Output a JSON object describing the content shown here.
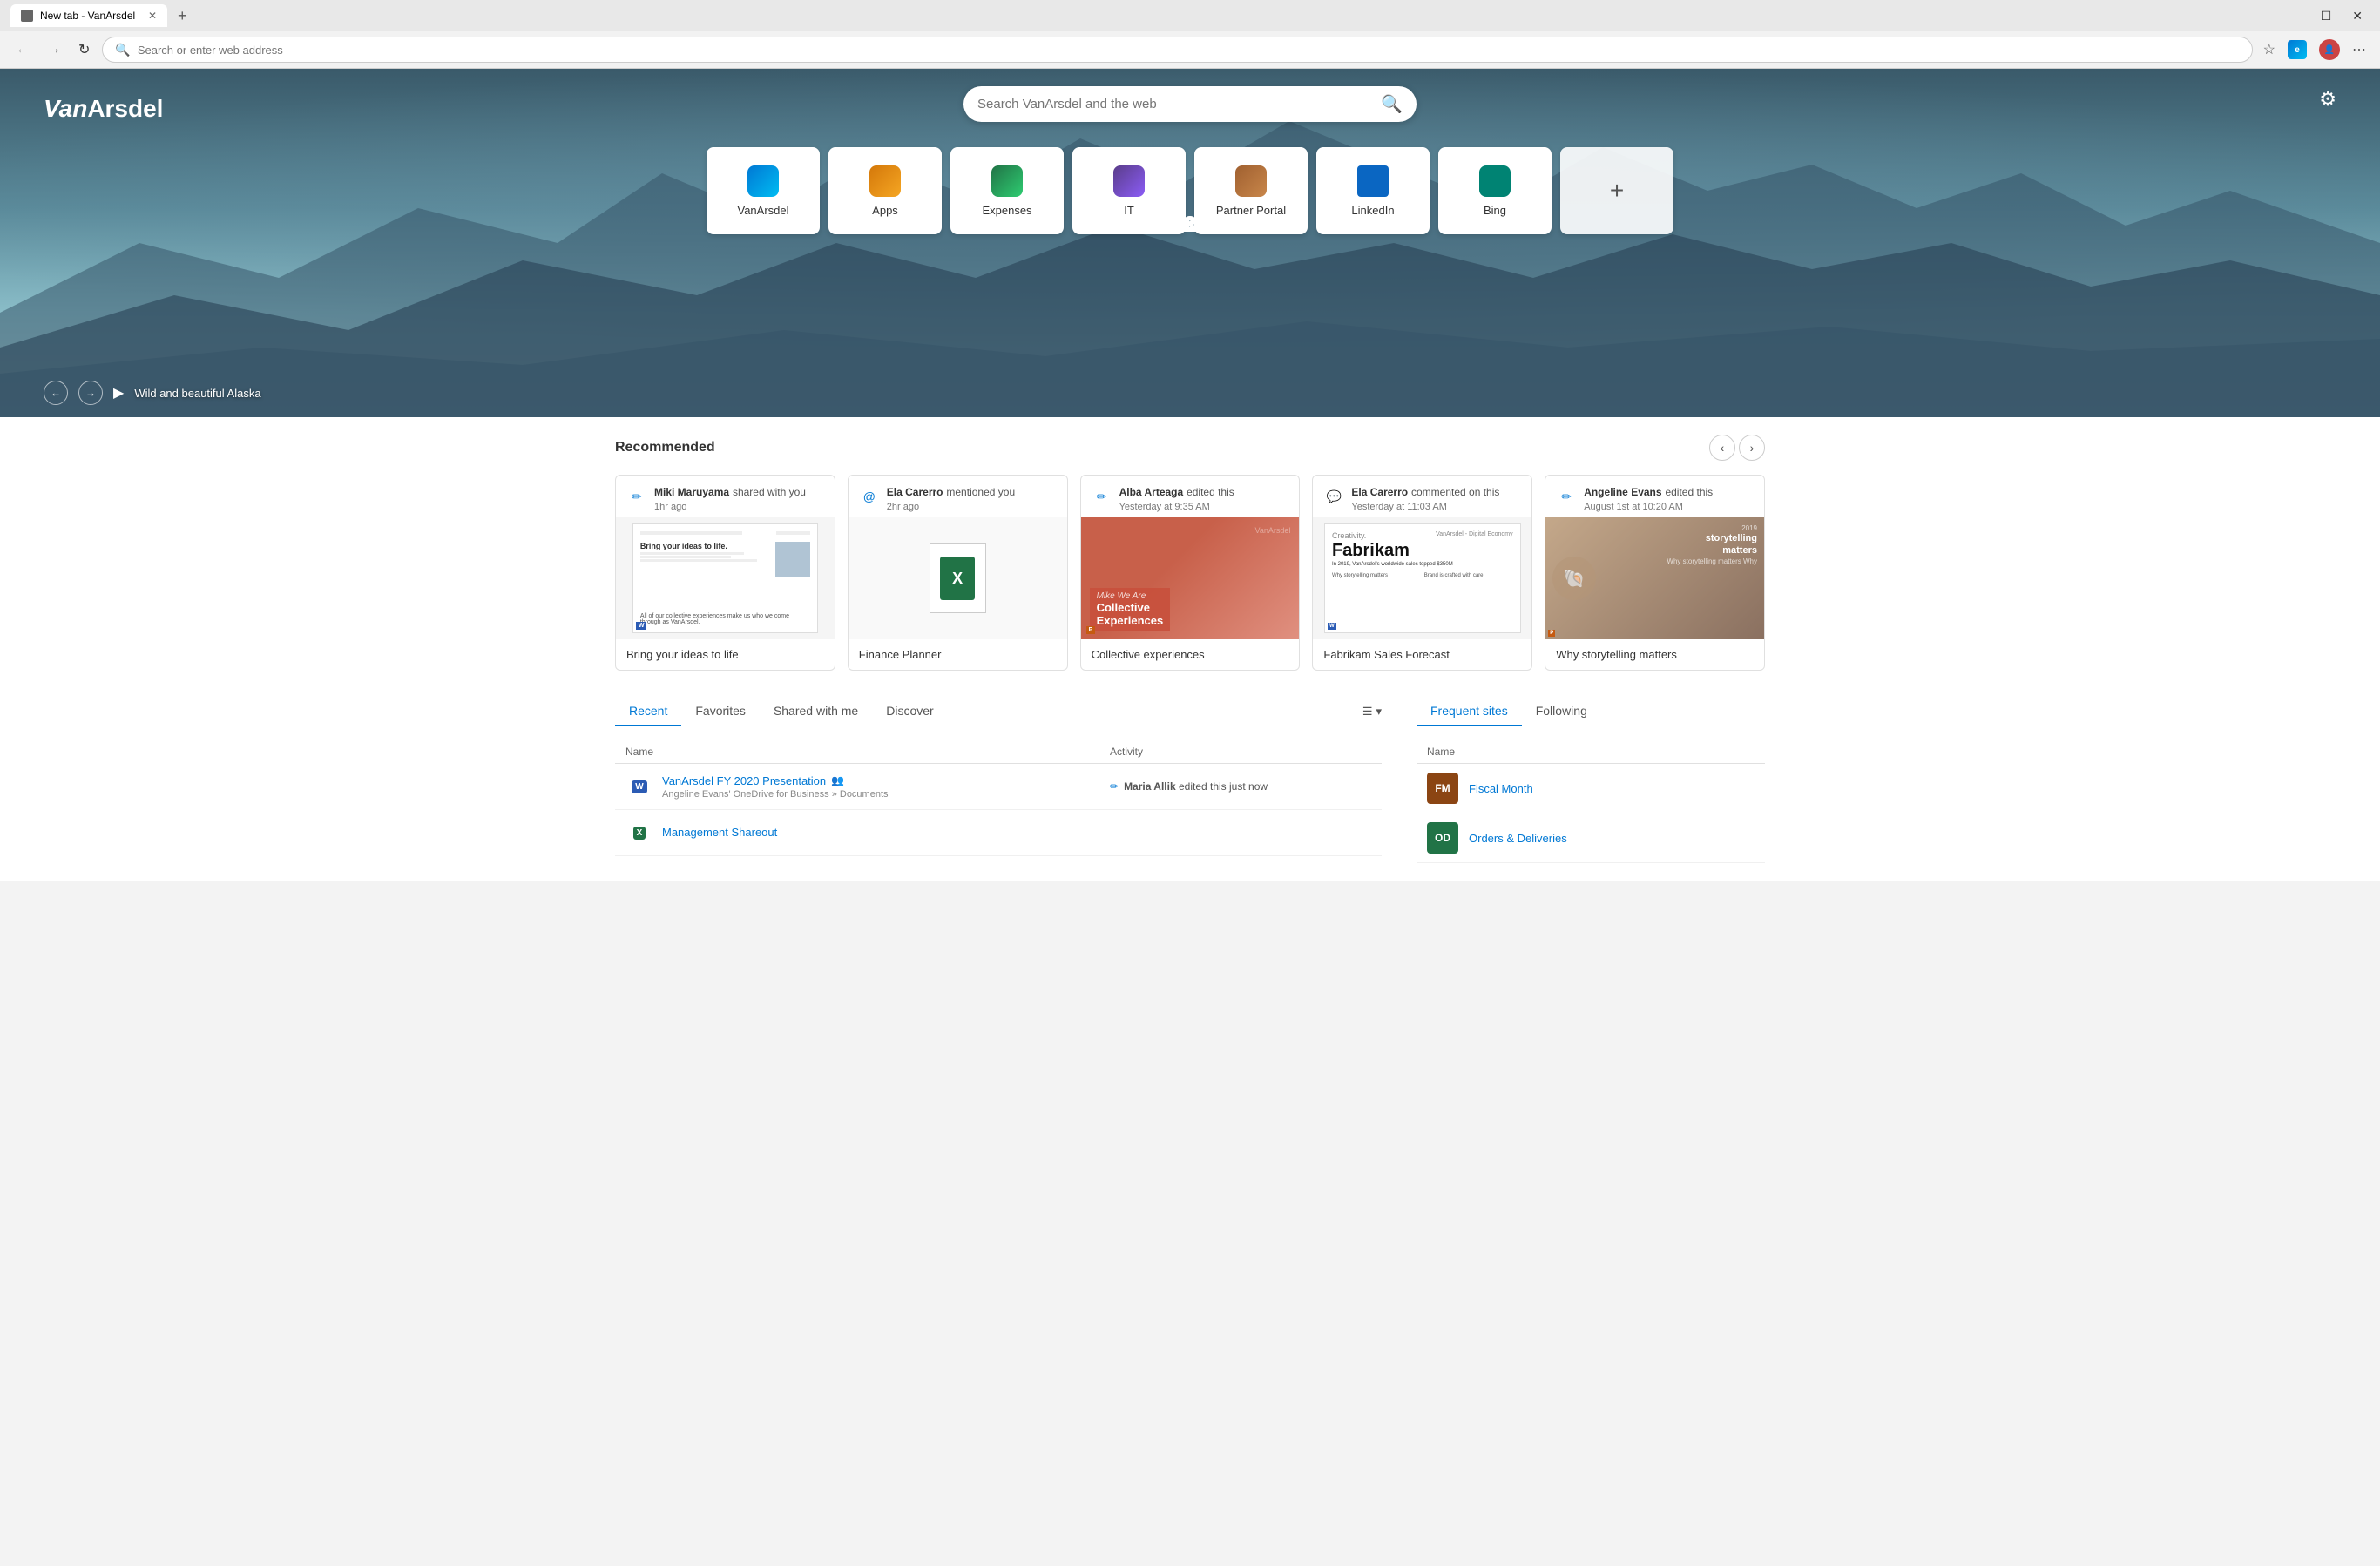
{
  "browser": {
    "tab_title": "New tab - VanArsdel",
    "new_tab_btn": "+",
    "address": "Search or enter web address",
    "win_minimize": "—",
    "win_maximize": "☐",
    "win_close": "✕"
  },
  "hero": {
    "logo": "VanArsdel",
    "search_placeholder": "Search VanArsdel and the web",
    "caption": "Wild and beautiful Alaska",
    "quick_links": [
      {
        "id": "vanarsdel",
        "label": "VanArsdel",
        "icon": "◉"
      },
      {
        "id": "apps",
        "label": "Apps",
        "icon": "⊞"
      },
      {
        "id": "expenses",
        "label": "Expenses",
        "icon": "⊟"
      },
      {
        "id": "it",
        "label": "IT",
        "icon": "▣"
      },
      {
        "id": "partner",
        "label": "Partner Portal",
        "icon": "⊡"
      },
      {
        "id": "linkedin",
        "label": "LinkedIn",
        "icon": "in"
      },
      {
        "id": "bing",
        "label": "Bing",
        "icon": "ᗯ"
      }
    ],
    "add_label": "+"
  },
  "recommended": {
    "title": "Recommended",
    "cards": [
      {
        "user": "Miki Maruyama",
        "action": "shared with you",
        "time": "1hr ago",
        "icon_type": "edit",
        "title": "Bring your ideas to life",
        "thumb_type": "word"
      },
      {
        "user": "Ela Carerro",
        "action": "mentioned you",
        "time": "2hr ago",
        "icon_type": "mention",
        "title": "Finance Planner",
        "thumb_type": "excel"
      },
      {
        "user": "Alba Arteaga",
        "action": "edited this",
        "time": "Yesterday at 9:35 AM",
        "icon_type": "edit",
        "title": "Collective experiences",
        "thumb_type": "collective"
      },
      {
        "user": "Ela Carerro",
        "action": "commented on this",
        "time": "Yesterday at 11:03 AM",
        "icon_type": "comment",
        "title": "Fabrikam Sales Forecast",
        "thumb_type": "fabrikam"
      },
      {
        "user": "Angeline Evans",
        "action": "edited this",
        "time": "August 1st at 10:20 AM",
        "icon_type": "edit",
        "title": "Why storytelling matters",
        "thumb_type": "storytelling"
      }
    ]
  },
  "files": {
    "tabs": [
      "Recent",
      "Favorites",
      "Shared with me",
      "Discover"
    ],
    "active_tab": "Recent",
    "headers": [
      "Name",
      "Activity"
    ],
    "rows": [
      {
        "icon": "word",
        "name": "VanArsdel FY 2020 Presentation",
        "shared": true,
        "path": "Angeline Evans' OneDrive for Business » Documents",
        "activity_user": "Maria Allik",
        "activity_action": "edited this just now"
      },
      {
        "icon": "excel",
        "name": "Management Shareout",
        "shared": false,
        "path": "",
        "activity_user": "",
        "activity_action": ""
      }
    ]
  },
  "sites": {
    "tabs": [
      "Frequent sites",
      "Following"
    ],
    "active_tab": "Frequent sites",
    "header": "Name",
    "rows": [
      {
        "abbr": "FM",
        "color": "#8b4513",
        "name": "Fiscal Month"
      },
      {
        "abbr": "OD",
        "color": "#217346",
        "name": "Orders & Deliveries"
      }
    ]
  }
}
